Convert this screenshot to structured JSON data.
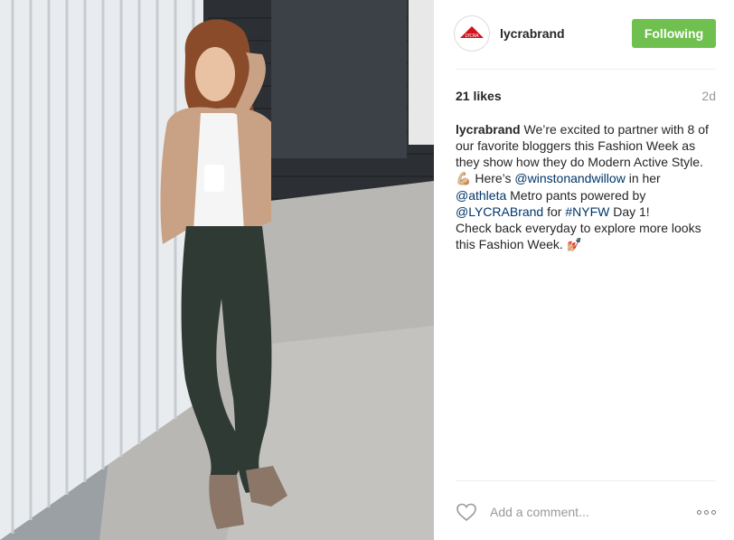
{
  "post": {
    "image_alt": "Woman in tan suede jacket, white top and dark green leggings leaning against a white wall",
    "username": "lycrabrand",
    "avatar_text": "LYCRA",
    "follow_label": "Following",
    "likes": "21 likes",
    "time": "2d",
    "caption": {
      "author": "lycrabrand",
      "text1": " We’re excited to partner with 8 of our favorite bloggers this Fashion Week as they show how they do Modern Active Style. ",
      "emoji1": "💪🏼",
      "text2": " Here’s ",
      "mention1": "@winstonandwillow",
      "text3": " in her ",
      "mention2": "@athleta",
      "text4": " Metro pants powered by ",
      "mention3": "@LYCRABrand",
      "text5": " for ",
      "hashtag": "#NYFW",
      "text6": " Day 1!",
      "line2": "Check back everyday to explore more looks this Fashion Week. ",
      "emoji2": "💅🏼"
    },
    "comment_placeholder": "Add a comment..."
  },
  "colors": {
    "follow_bg": "#70c050",
    "link": "#003569",
    "muted": "#999999"
  }
}
